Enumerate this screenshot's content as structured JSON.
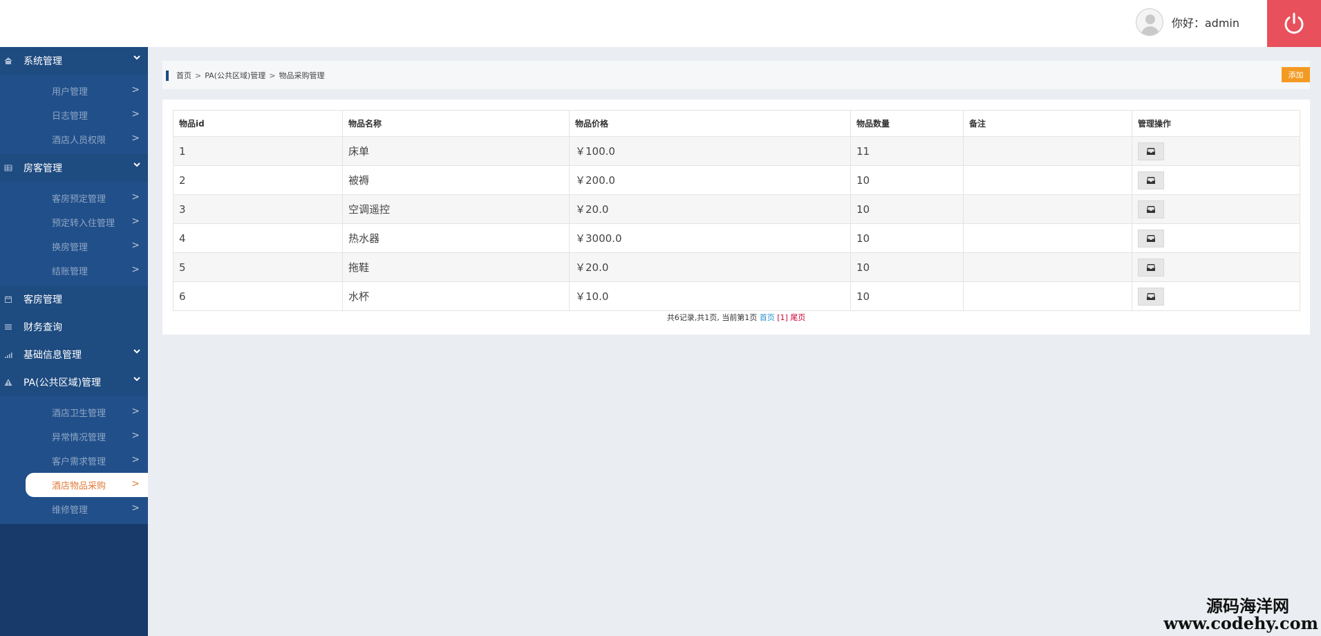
{
  "header": {
    "greeting": "你好：admin",
    "power_icon": "power-icon",
    "accent": "#e8505b"
  },
  "sidebar": {
    "groups": [
      {
        "label": "系统管理",
        "icon": "home-icon",
        "items": [
          "用户管理",
          "日志管理",
          "酒店人员权限"
        ]
      },
      {
        "label": "房客管理",
        "icon": "table-icon",
        "items": [
          "客房预定管理",
          "预定转入住管理",
          "换房管理",
          "结账管理"
        ]
      },
      {
        "label": "客房管理",
        "icon": "calendar-icon"
      },
      {
        "label": "财务查询",
        "icon": "list-icon"
      },
      {
        "label": "基础信息管理",
        "icon": "signal-icon"
      },
      {
        "label": "PA(公共区域)管理",
        "icon": "warning-icon",
        "items": [
          "酒店卫生管理",
          "异常情况管理",
          "客户需求管理",
          "酒店物品采购",
          "维修管理"
        ]
      }
    ],
    "active_item": "酒店物品采购",
    "arrow": ">"
  },
  "breadcrumb": {
    "home": "首页",
    "level1": "PA(公共区域)管理",
    "current": "物品采购管理",
    "sep": ">"
  },
  "toolbar": {
    "add_label": "添加",
    "add_color": "#f39a22"
  },
  "table": {
    "headers": [
      "物品id",
      "物品名称",
      "物品价格",
      "物品数量",
      "备注",
      "管理操作"
    ],
    "rows": [
      [
        "1",
        "床单",
        "￥100.0",
        "11",
        ""
      ],
      [
        "2",
        "被褥",
        "￥200.0",
        "10",
        ""
      ],
      [
        "3",
        "空调遥控",
        "￥20.0",
        "10",
        ""
      ],
      [
        "4",
        "热水器",
        "￥3000.0",
        "10",
        ""
      ],
      [
        "5",
        "拖鞋",
        "￥20.0",
        "10",
        ""
      ],
      [
        "6",
        "水杯",
        "￥10.0",
        "10",
        ""
      ]
    ],
    "row_action_icon": "inbox-icon"
  },
  "pager": {
    "summary": "共6记录,共1页, 当前第1页",
    "first": "首页",
    "current": "[1]",
    "last": "尾页"
  },
  "watermark": {
    "line1": "源码海洋网",
    "line2": "www.codehy.com"
  }
}
